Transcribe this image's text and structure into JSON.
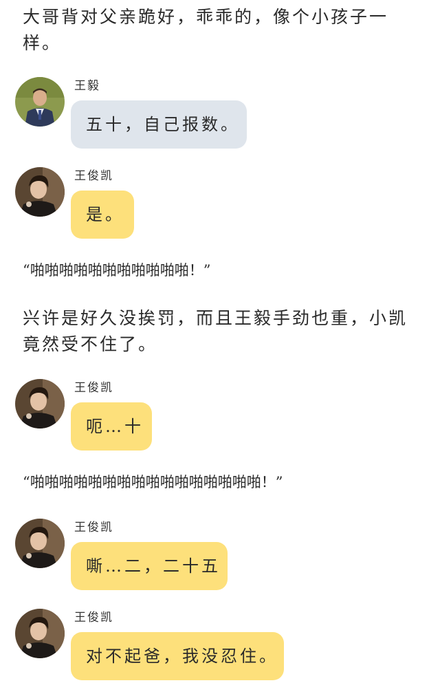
{
  "narration": {
    "line1": "大哥背对父亲跪好，乖乖的，像个小孩子一样。",
    "line2": "兴许是好久没挨罚，而且王毅手劲也重，小凯竟然受不住了。"
  },
  "sfx": {
    "first": "“啪啪啪啪啪啪啪啪啪啪啪！”",
    "second": "“啪啪啪啪啪啪啪啪啪啪啪啪啪啪啪啪！”"
  },
  "messages": [
    {
      "speaker": "王毅",
      "text": "五十，自己报数。",
      "bubble_color": "#dfe5ec"
    },
    {
      "speaker": "王俊凯",
      "text": "是。",
      "bubble_color": "#fde07b"
    },
    {
      "speaker": "王俊凯",
      "text": "呃…十",
      "bubble_color": "#fde07b"
    },
    {
      "speaker": "王俊凯",
      "text": "嘶…二，二十五",
      "bubble_color": "#fde07b"
    },
    {
      "speaker": "王俊凯",
      "text": "对不起爸，我没忍住。",
      "bubble_color": "#fde07b"
    }
  ]
}
